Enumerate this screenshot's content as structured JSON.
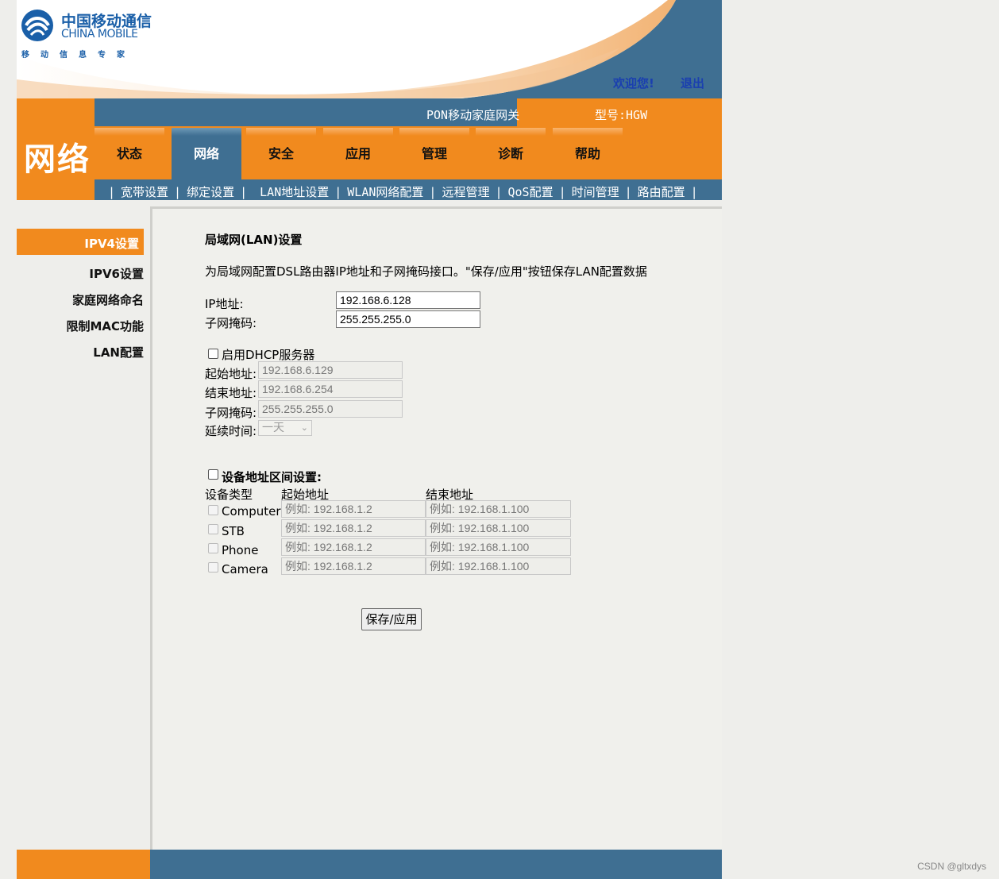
{
  "header": {
    "logo_cn": "中国移动通信",
    "logo_en": "CHINA MOBILE",
    "logo_sub": "移动信息专家",
    "welcome": "欢迎您!",
    "logout": "退出",
    "gateway_name": "PON移动家庭网关",
    "model": "型号:HGW"
  },
  "section_title": "网络",
  "tabs": [
    {
      "label": "状态"
    },
    {
      "label": "网络"
    },
    {
      "label": "安全"
    },
    {
      "label": "应用"
    },
    {
      "label": "管理"
    },
    {
      "label": "诊断"
    },
    {
      "label": "帮助"
    }
  ],
  "subnav": [
    "宽带设置",
    "绑定设置",
    "LAN地址设置",
    "WLAN网络配置",
    "远程管理",
    "QoS配置",
    "时间管理",
    "路由配置"
  ],
  "sidebar": {
    "active": "IPV4设置",
    "items": [
      "IPV6设置",
      "家庭网络命名",
      "限制MAC功能",
      "LAN配置"
    ]
  },
  "main": {
    "title": "局域网(LAN)设置",
    "description": "为局域网配置DSL路由器IP地址和子网掩码接口。\"保存/应用\"按钮保存LAN配置数据",
    "ip_label": "IP地址:",
    "ip_value": "192.168.6.128",
    "mask_label": "子网掩码:",
    "mask_value": "255.255.255.0",
    "dhcp": {
      "enable_label": "启用DHCP服务器",
      "enabled": false,
      "start_label": "起始地址:",
      "start_value": "192.168.6.129",
      "end_label": "结束地址:",
      "end_value": "192.168.6.254",
      "mask_label": "子网掩码:",
      "mask_value": "255.255.255.0",
      "lease_label": "延续时间:",
      "lease_value": "一天"
    },
    "range": {
      "enable_label": "设备地址区间设置:",
      "enabled": false,
      "col_type": "设备类型",
      "col_start": "起始地址",
      "col_end": "结束地址",
      "rows": [
        {
          "type": "Computer",
          "start_placeholder": "例如: 192.168.1.2",
          "end_placeholder": "例如: 192.168.1.100"
        },
        {
          "type": "STB",
          "start_placeholder": "例如: 192.168.1.2",
          "end_placeholder": "例如: 192.168.1.100"
        },
        {
          "type": "Phone",
          "start_placeholder": "例如: 192.168.1.2",
          "end_placeholder": "例如: 192.168.1.100"
        },
        {
          "type": "Camera",
          "start_placeholder": "例如: 192.168.1.2",
          "end_placeholder": "例如: 192.168.1.100"
        }
      ]
    },
    "save_button": "保存/应用"
  },
  "watermark": "CSDN @gltxdys",
  "colors": {
    "orange": "#f18a1e",
    "blue": "#3f6f92",
    "link": "#1a3fb0"
  }
}
